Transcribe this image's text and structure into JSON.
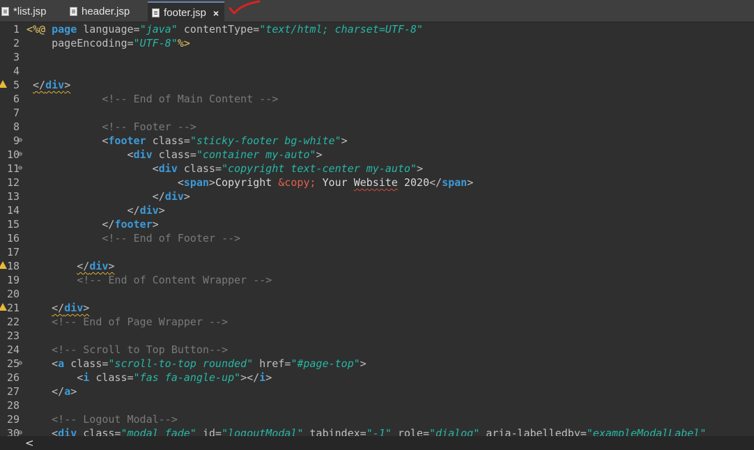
{
  "tabs": [
    {
      "label": "*list.jsp"
    },
    {
      "label": "header.jsp"
    },
    {
      "label": "footer.jsp",
      "close": "×"
    }
  ],
  "lines": [
    {
      "n": "1",
      "seg": [
        {
          "c": "d",
          "t": "<%@ "
        },
        {
          "c": "k",
          "t": "page "
        },
        {
          "c": "a",
          "t": "language="
        },
        {
          "c": "s",
          "t": "\"java\""
        },
        {
          "c": "a",
          "t": " contentType="
        },
        {
          "c": "s",
          "t": "\"text/html; charset=UTF-8\""
        }
      ]
    },
    {
      "n": "2",
      "seg": [
        {
          "c": "a",
          "t": "    pageEncoding="
        },
        {
          "c": "s",
          "t": "\"UTF-8\""
        },
        {
          "c": "d",
          "t": "%>"
        }
      ]
    },
    {
      "n": "3",
      "seg": []
    },
    {
      "n": "4",
      "seg": []
    },
    {
      "n": "5",
      "warn": true,
      "seg": [
        {
          "c": "p",
          "t": " "
        },
        {
          "c": "p sq",
          "t": "</"
        },
        {
          "c": "k sq",
          "t": "div"
        },
        {
          "c": "p sq",
          "t": ">"
        }
      ]
    },
    {
      "n": "6",
      "seg": [
        {
          "c": "c",
          "t": "            <!-- End of Main Content -->"
        }
      ]
    },
    {
      "n": "7",
      "seg": []
    },
    {
      "n": "8",
      "seg": [
        {
          "c": "c",
          "t": "            <!-- Footer -->"
        }
      ]
    },
    {
      "n": "9",
      "fold": true,
      "seg": [
        {
          "c": "p",
          "t": "            <"
        },
        {
          "c": "k",
          "t": "footer "
        },
        {
          "c": "a",
          "t": "class="
        },
        {
          "c": "s",
          "t": "\"sticky-footer bg-white\""
        },
        {
          "c": "p",
          "t": ">"
        }
      ]
    },
    {
      "n": "10",
      "fold": true,
      "seg": [
        {
          "c": "p",
          "t": "                <"
        },
        {
          "c": "k",
          "t": "div "
        },
        {
          "c": "a",
          "t": "class="
        },
        {
          "c": "s",
          "t": "\"container my-auto\""
        },
        {
          "c": "p",
          "t": ">"
        }
      ]
    },
    {
      "n": "11",
      "fold": true,
      "seg": [
        {
          "c": "p",
          "t": "                    <"
        },
        {
          "c": "k",
          "t": "div "
        },
        {
          "c": "a",
          "t": "class="
        },
        {
          "c": "s",
          "t": "\"copyright text-center my-auto\""
        },
        {
          "c": "p",
          "t": ">"
        }
      ]
    },
    {
      "n": "12",
      "seg": [
        {
          "c": "p",
          "t": "                        <"
        },
        {
          "c": "k",
          "t": "span"
        },
        {
          "c": "p",
          "t": ">"
        },
        {
          "c": "t",
          "t": "Copyright "
        },
        {
          "c": "e",
          "t": "&copy;"
        },
        {
          "c": "t",
          "t": " Your "
        },
        {
          "c": "t sp",
          "t": "Website"
        },
        {
          "c": "t",
          "t": " 2020"
        },
        {
          "c": "p",
          "t": "</"
        },
        {
          "c": "k",
          "t": "span"
        },
        {
          "c": "p",
          "t": ">"
        }
      ]
    },
    {
      "n": "13",
      "seg": [
        {
          "c": "p",
          "t": "                    </"
        },
        {
          "c": "k",
          "t": "div"
        },
        {
          "c": "p",
          "t": ">"
        }
      ]
    },
    {
      "n": "14",
      "seg": [
        {
          "c": "p",
          "t": "                </"
        },
        {
          "c": "k",
          "t": "div"
        },
        {
          "c": "p",
          "t": ">"
        }
      ]
    },
    {
      "n": "15",
      "seg": [
        {
          "c": "p",
          "t": "            </"
        },
        {
          "c": "k",
          "t": "footer"
        },
        {
          "c": "p",
          "t": ">"
        }
      ]
    },
    {
      "n": "16",
      "seg": [
        {
          "c": "c",
          "t": "            <!-- End of Footer -->"
        }
      ]
    },
    {
      "n": "17",
      "seg": []
    },
    {
      "n": "18",
      "warn": true,
      "seg": [
        {
          "c": "p",
          "t": "        "
        },
        {
          "c": "p sq",
          "t": "</"
        },
        {
          "c": "k sq",
          "t": "div"
        },
        {
          "c": "p sq",
          "t": ">"
        }
      ]
    },
    {
      "n": "19",
      "seg": [
        {
          "c": "c",
          "t": "        <!-- End of Content Wrapper -->"
        }
      ]
    },
    {
      "n": "20",
      "seg": []
    },
    {
      "n": "21",
      "warn": true,
      "seg": [
        {
          "c": "p",
          "t": "    "
        },
        {
          "c": "p sq",
          "t": "</"
        },
        {
          "c": "k sq",
          "t": "div"
        },
        {
          "c": "p sq",
          "t": ">"
        }
      ]
    },
    {
      "n": "22",
      "seg": [
        {
          "c": "c",
          "t": "    <!-- End of Page Wrapper -->"
        }
      ]
    },
    {
      "n": "23",
      "seg": []
    },
    {
      "n": "24",
      "seg": [
        {
          "c": "c",
          "t": "    <!-- Scroll to Top Button-->"
        }
      ]
    },
    {
      "n": "25",
      "fold": true,
      "seg": [
        {
          "c": "p",
          "t": "    <"
        },
        {
          "c": "k",
          "t": "a "
        },
        {
          "c": "a",
          "t": "class="
        },
        {
          "c": "s",
          "t": "\"scroll-to-top rounded\""
        },
        {
          "c": "a",
          "t": " href="
        },
        {
          "c": "s",
          "t": "\"#page-top\""
        },
        {
          "c": "p",
          "t": ">"
        }
      ]
    },
    {
      "n": "26",
      "seg": [
        {
          "c": "p",
          "t": "        <"
        },
        {
          "c": "k",
          "t": "i "
        },
        {
          "c": "a",
          "t": "class="
        },
        {
          "c": "s",
          "t": "\"fas fa-angle-up\""
        },
        {
          "c": "p",
          "t": "></"
        },
        {
          "c": "k",
          "t": "i"
        },
        {
          "c": "p",
          "t": ">"
        }
      ]
    },
    {
      "n": "27",
      "seg": [
        {
          "c": "p",
          "t": "    </"
        },
        {
          "c": "k",
          "t": "a"
        },
        {
          "c": "p",
          "t": ">"
        }
      ]
    },
    {
      "n": "28",
      "seg": []
    },
    {
      "n": "29",
      "seg": [
        {
          "c": "c",
          "t": "    <!-- Logout Modal-->"
        }
      ]
    },
    {
      "n": "30",
      "fold": true,
      "seg": [
        {
          "c": "p",
          "t": "    <"
        },
        {
          "c": "k",
          "t": "div "
        },
        {
          "c": "a",
          "t": "class="
        },
        {
          "c": "s",
          "t": "\"modal fade\""
        },
        {
          "c": "a",
          "t": " id="
        },
        {
          "c": "s",
          "t": "\"logoutModal\""
        },
        {
          "c": "a",
          "t": " tabindex="
        },
        {
          "c": "s",
          "t": "\"-1\""
        },
        {
          "c": "a",
          "t": " role="
        },
        {
          "c": "s",
          "t": "\"dialog\""
        },
        {
          "c": "a",
          "t": " aria-labelledby="
        },
        {
          "c": "s",
          "t": "\"exampleModalLabel\""
        }
      ]
    }
  ],
  "scrollbar": {
    "arrow": "<"
  },
  "colors": {
    "background": "#2f2f2f",
    "tag": "#3d9bd9",
    "string": "#27b7a5",
    "comment": "#7a7a7a",
    "entity": "#e3604e",
    "directive": "#e3c766"
  }
}
